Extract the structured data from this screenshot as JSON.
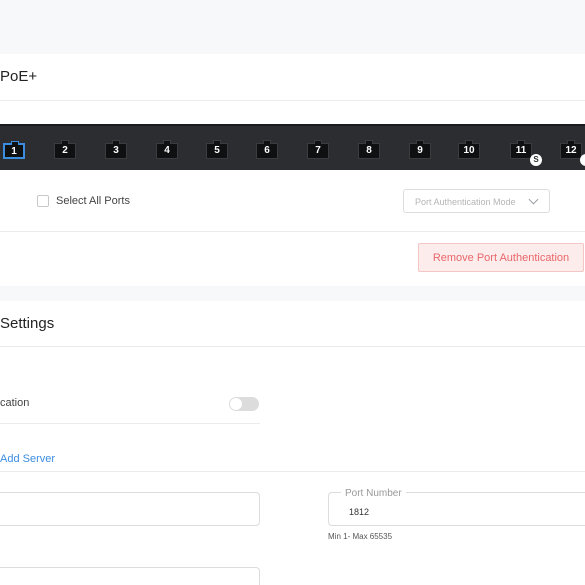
{
  "poe_section": {
    "title": "PoE+",
    "ports": [
      {
        "label": "1",
        "selected": true
      },
      {
        "label": "2",
        "selected": false
      },
      {
        "label": "3",
        "selected": false
      },
      {
        "label": "4",
        "selected": false
      },
      {
        "label": "5",
        "selected": false
      },
      {
        "label": "6",
        "selected": false
      },
      {
        "label": "7",
        "selected": false
      },
      {
        "label": "8",
        "selected": false
      },
      {
        "label": "9",
        "selected": false
      },
      {
        "label": "10",
        "selected": false
      },
      {
        "label": "11",
        "selected": false,
        "badge": "S"
      },
      {
        "label": "12",
        "selected": false
      }
    ],
    "select_all_label": "Select All Ports",
    "auth_mode_placeholder": "Port Authentication Mode",
    "remove_button_label": "Remove Port Authentication"
  },
  "settings_section": {
    "title": "Settings",
    "toggle_label": "cation",
    "toggle_on": false,
    "add_server_label": "Add Server",
    "port_number": {
      "label": "Port Number",
      "value": "1812",
      "hint": "Min 1- Max 65535"
    }
  },
  "colors": {
    "accent": "#3b8de0",
    "danger": "#e8676b",
    "port_strip": "#2b2d31"
  }
}
